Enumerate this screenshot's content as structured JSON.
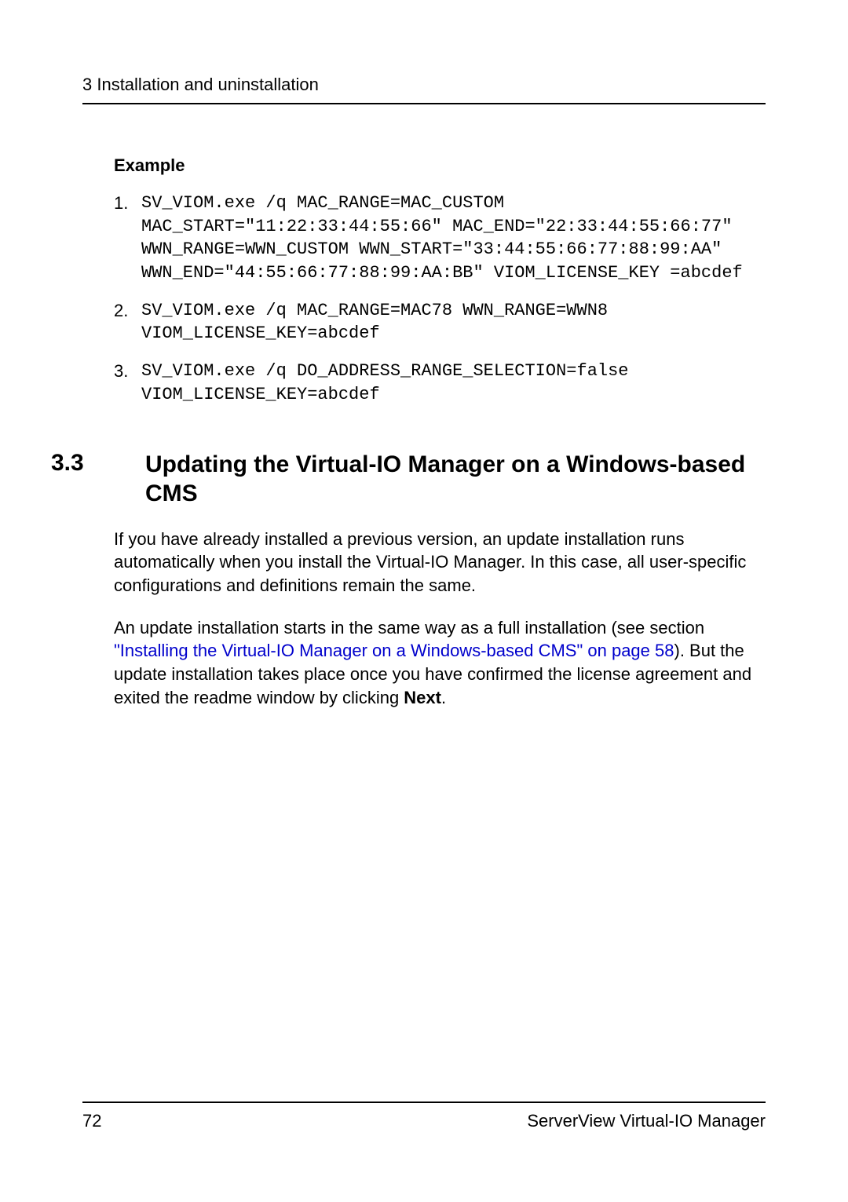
{
  "header": {
    "breadcrumb": "3 Installation and uninstallation"
  },
  "example": {
    "heading": "Example",
    "items": [
      {
        "num": "1.",
        "code": "SV_VIOM.exe /q MAC_RANGE=MAC_CUSTOM MAC_START=\"11:22:33:44:55:66\" MAC_END=\"22:33:44:55:66:77\" WWN_RANGE=WWN_CUSTOM WWN_START=\"33:44:55:66:77:88:99:AA\" WWN_END=\"44:55:66:77:88:99:AA:BB\" VIOM_LICENSE_KEY =abcdef"
      },
      {
        "num": "2.",
        "code": "SV_VIOM.exe /q MAC_RANGE=MAC78 WWN_RANGE=WWN8 VIOM_LICENSE_KEY=abcdef"
      },
      {
        "num": "3.",
        "code": "SV_VIOM.exe /q DO_ADDRESS_RANGE_SELECTION=false VIOM_LICENSE_KEY=abcdef"
      }
    ]
  },
  "section": {
    "num": "3.3",
    "title": "Updating the Virtual-IO Manager on a Windows-based CMS",
    "para1": "If you have already installed a previous version, an update installation runs automatically when you install the Virtual-IO Manager. In this case, all user-specific configurations and definitions remain the same.",
    "para2_pre": "An update installation starts in the same way as a full installation (see section ",
    "para2_link": "\"Installing the Virtual-IO Manager on a Windows-based CMS\" on page 58",
    "para2_post1": "). But the update installation takes place once you have confirmed the license agreement and exited the readme window by clicking ",
    "para2_bold": "Next",
    "para2_post2": "."
  },
  "footer": {
    "page": "72",
    "title": "ServerView Virtual-IO Manager"
  }
}
